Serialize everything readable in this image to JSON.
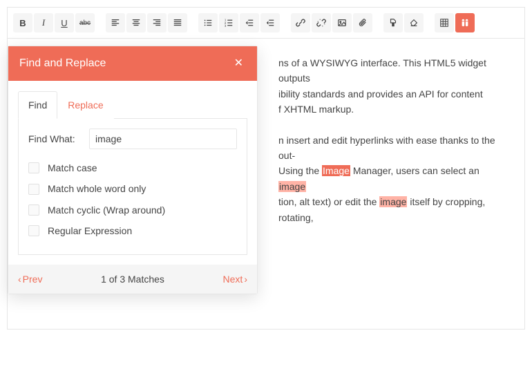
{
  "toolbar": {
    "bold": "B",
    "italic": "I",
    "underline": "U",
    "strike": "abc",
    "align_left": "left",
    "align_center": "center",
    "align_right": "right",
    "align_justify": "justify",
    "list_ul": "ul",
    "list_ol": "ol",
    "outdent": "outdent",
    "indent": "indent",
    "link": "link",
    "unlink": "unlink",
    "image": "image",
    "attach": "attach",
    "format_paint": "paint",
    "clear_format": "clear",
    "table": "table",
    "find": "find"
  },
  "dialog": {
    "title": "Find and Replace",
    "tabs": {
      "find": "Find",
      "replace": "Replace"
    },
    "find_label": "Find What:",
    "find_value": "image",
    "options": {
      "match_case": "Match case",
      "whole_word": "Match whole word only",
      "cyclic": "Match cyclic (Wrap around)",
      "regex": "Regular Expression"
    },
    "footer": {
      "prev": "Prev",
      "next": "Next",
      "status": "1 of 3 Matches"
    }
  },
  "content": {
    "p1_a": "ns of a WYSIWYG interface. This HTML5 widget outputs ",
    "p1_b": "ibility standards and provides an API for content ",
    "p1_c": "f XHTML markup.",
    "p2_a": "n insert and edit hyperlinks with ease thanks to the out-",
    "p2_b": " Using the ",
    "p2_hl1": "Image",
    "p2_c": " Manager, users can select an ",
    "p2_hl2": "image",
    "p2_d": "tion, alt text) or edit the ",
    "p2_hl3": "image",
    "p2_e": " itself by cropping, rotating,"
  }
}
